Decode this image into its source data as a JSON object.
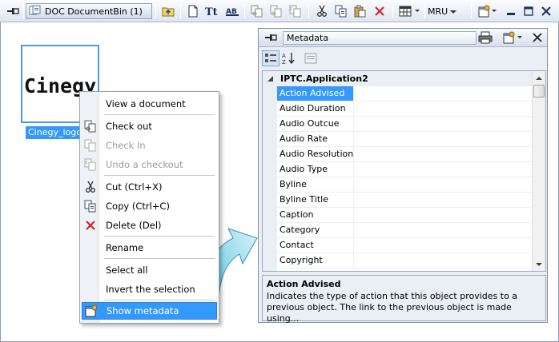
{
  "toolbar": {
    "doc_tab_label": "DOC DocumentBin (1)",
    "mru_label": "MRU",
    "icons": [
      "pin-icon",
      "bin-icon",
      "folder-up-icon",
      "new-document-icon",
      "text-format-icon",
      "rename-label-icon",
      "check-out-icon",
      "check-in-icon",
      "undo-checkout-icon",
      "cut-icon",
      "copy-icon",
      "paste-icon",
      "delete-icon",
      "view-mode-icon",
      "properties-icon",
      "minimize-icon",
      "maximize-icon",
      "close-icon"
    ]
  },
  "thumbnail": {
    "logo_text": "Cinegy",
    "file_label": "Cinegy_logo.",
    "selection_color": "#3399ff"
  },
  "context_menu": {
    "items": [
      {
        "label": "View a document",
        "icon": "",
        "disabled": false
      },
      {
        "label": "Check out",
        "icon": "check-out-icon",
        "disabled": false
      },
      {
        "label": "Check In",
        "icon": "check-in-icon",
        "disabled": true
      },
      {
        "label": "Undo a checkout",
        "icon": "undo-checkout-icon",
        "disabled": true
      },
      {
        "label": "Cut (Ctrl+X)",
        "icon": "cut-icon",
        "disabled": false
      },
      {
        "label": "Copy (Ctrl+C)",
        "icon": "copy-icon",
        "disabled": false
      },
      {
        "label": "Delete (Del)",
        "icon": "delete-icon",
        "disabled": false
      },
      {
        "label": "Rename",
        "icon": "",
        "disabled": false
      },
      {
        "label": "Select all",
        "icon": "",
        "disabled": false
      },
      {
        "label": "Invert the selection",
        "icon": "",
        "disabled": false
      },
      {
        "label": "Show metadata",
        "icon": "metadata-icon",
        "disabled": false,
        "highlighted": true
      }
    ]
  },
  "metadata_panel": {
    "title": "Metadata",
    "category": "IPTC.Application2",
    "properties": [
      "Action Advised",
      "Audio Duration",
      "Audio Outcue",
      "Audio Rate",
      "Audio Resolution",
      "Audio Type",
      "Byline",
      "Byline Title",
      "Caption",
      "Category",
      "Contact",
      "Copyright"
    ],
    "selected_property": "Action Advised",
    "description_title": "Action Advised",
    "description_text": "Indicates the type of action that this object provides to a previous object. The link to the previous object is made using..."
  }
}
